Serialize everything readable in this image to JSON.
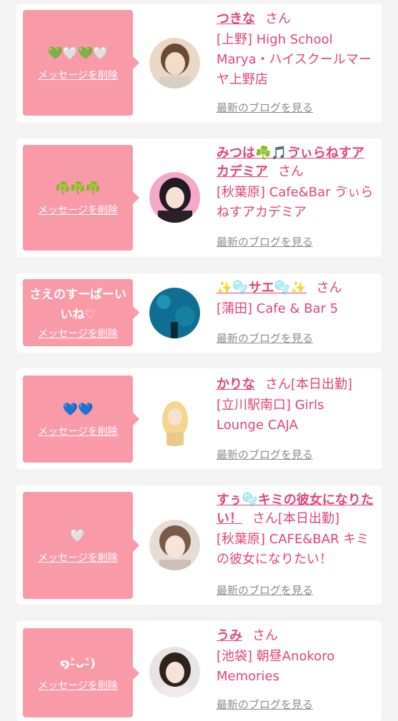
{
  "theme": {
    "accent": "#e2437a",
    "bubble": "#f99aa8",
    "link_gray": "#8b8b8b"
  },
  "items": [
    {
      "message": "💚🤍💚🤍",
      "delete_label": "メッセージを削除",
      "name": "つきな",
      "honorific": "さん",
      "status": "",
      "shop": "[上野] High School Marya・ハイスクールマーヤ上野店",
      "blog_label": "最新のブログを見る"
    },
    {
      "message": "☘️☘️☘️",
      "delete_label": "メッセージを削除",
      "name": "みつは☘️🎵ゔぃらねすアカデミア",
      "honorific": "さん",
      "status": "",
      "shop": "[秋葉原] Cafe&Bar ゔぃらねすアカデミア",
      "blog_label": "最新のブログを見る"
    },
    {
      "message": "さえのすーぱーいいね♡",
      "delete_label": "メッセージを削除",
      "name": "✨🫧サエ🫧✨",
      "honorific": "さん",
      "status": "",
      "shop": "[蒲田] Cafe & Bar 5",
      "blog_label": "最新のブログを見る"
    },
    {
      "message": "💙💙",
      "delete_label": "メッセージを削除",
      "name": "かりな",
      "honorific": "さん",
      "status": "[本日出勤]",
      "shop": "[立川駅南口] Girls Lounge CAJA",
      "blog_label": "最新のブログを見る"
    },
    {
      "message": "🤍",
      "delete_label": "メッセージを削除",
      "name": "すぅ🫧キミの彼女になりたい！",
      "honorific": "さん",
      "status": "[本日出勤]",
      "shop": "[秋葉原] CAFE&BAR キミの彼女になりたい！",
      "blog_label": "最新のブログを見る"
    },
    {
      "message": "໑˃̵ᴗ˂̵)",
      "delete_label": "メッセージを削除",
      "name": "うみ",
      "honorific": "さん",
      "status": "",
      "shop": "[池袋] 朝昼Anokoro Memories",
      "blog_label": "最新のブログを見る"
    }
  ]
}
